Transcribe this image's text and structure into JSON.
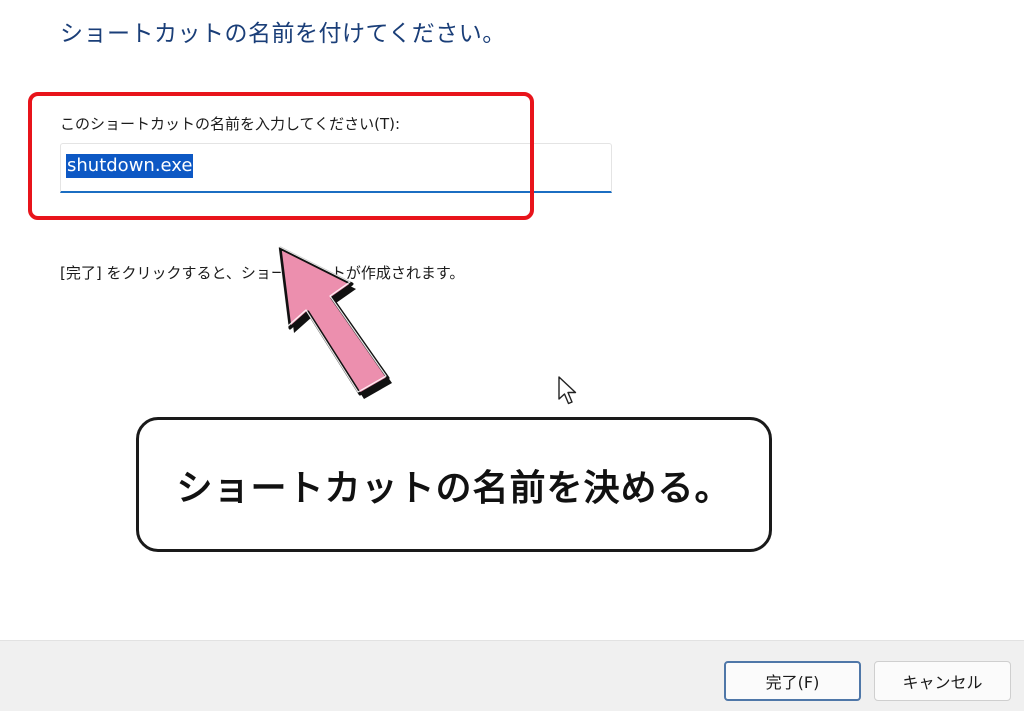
{
  "dialog": {
    "title": "ショートカットの名前を付けてください。",
    "name_label": "このショートカットの名前を入力してください(T):",
    "name_value": "shutdown.exe",
    "finish_hint": "[完了] をクリックすると、ショートカットが作成されます。"
  },
  "annotation": {
    "caption": "ショートカットの名前を決める。",
    "highlight_color": "#e8141b",
    "arrow_color": "#ec8fae",
    "arrow_icon": "arrow-up-left-icon"
  },
  "footer": {
    "finish_label": "完了(F)",
    "cancel_label": "キャンセル"
  },
  "colors": {
    "title": "#1a3e78",
    "selection": "#0d58c4",
    "input_underline": "#1b6ec2"
  }
}
